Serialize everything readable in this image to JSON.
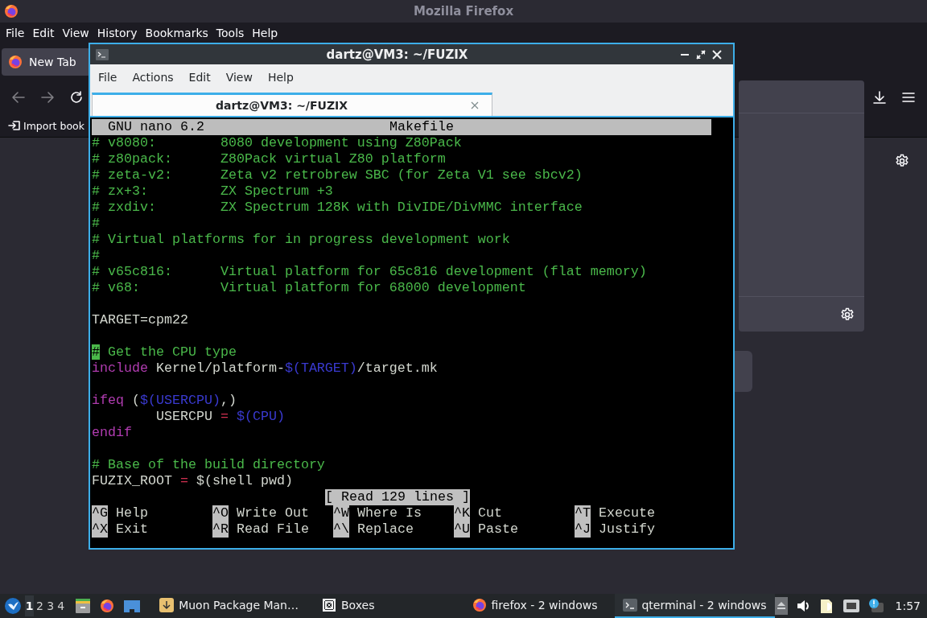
{
  "firefox": {
    "title": "Mozilla Firefox",
    "menu": [
      "File",
      "Edit",
      "View",
      "History",
      "Bookmarks",
      "Tools",
      "Help"
    ],
    "tabs": [
      {
        "label": "New Tab",
        "selected": true
      }
    ],
    "bookmarks": [
      "Import book"
    ]
  },
  "terminal": {
    "title": "dartz@VM3: ~/FUZIX",
    "menu": [
      "File",
      "Actions",
      "Edit",
      "View",
      "Help"
    ],
    "tabs": [
      {
        "label": "dartz@VM3: ~/FUZIX",
        "selected": true
      }
    ],
    "nano": {
      "version": "GNU nano 6.2",
      "filename": "Makefile",
      "lines": [
        {
          "kind": "text",
          "segments": [
            {
              "kind": "comment",
              "text": "# v8080:        8080 development using Z80Pack"
            }
          ]
        },
        {
          "kind": "text",
          "segments": [
            {
              "kind": "comment",
              "text": "# z80pack:      Z80Pack virtual Z80 platform"
            }
          ]
        },
        {
          "kind": "text",
          "segments": [
            {
              "kind": "comment",
              "text": "# zeta-v2:      Zeta v2 retrobrew SBC (for Zeta V1 see sbcv2)"
            }
          ]
        },
        {
          "kind": "text",
          "segments": [
            {
              "kind": "comment",
              "text": "# zx+3:         ZX Spectrum +3"
            }
          ]
        },
        {
          "kind": "text",
          "segments": [
            {
              "kind": "comment",
              "text": "# zxdiv:        ZX Spectrum 128K with DivIDE/DivMMC interface"
            }
          ]
        },
        {
          "kind": "text",
          "segments": [
            {
              "kind": "comment",
              "text": "#"
            }
          ]
        },
        {
          "kind": "text",
          "segments": [
            {
              "kind": "comment",
              "text": "# Virtual platforms for in progress development work"
            }
          ]
        },
        {
          "kind": "text",
          "segments": [
            {
              "kind": "comment",
              "text": "#"
            }
          ]
        },
        {
          "kind": "text",
          "segments": [
            {
              "kind": "comment",
              "text": "# v65c816:      Virtual platform for 65c816 development (flat memory)"
            }
          ]
        },
        {
          "kind": "text",
          "segments": [
            {
              "kind": "comment",
              "text": "# v68:          Virtual platform for 68000 development"
            }
          ]
        },
        {
          "kind": "blank"
        },
        {
          "kind": "text",
          "segments": [
            {
              "kind": "plain",
              "text": "TARGET=cpm22"
            }
          ]
        },
        {
          "kind": "blank"
        },
        {
          "kind": "text",
          "segments": [
            {
              "kind": "cursor",
              "text": "#"
            },
            {
              "kind": "comment",
              "text": " Get the CPU type"
            }
          ]
        },
        {
          "kind": "text",
          "segments": [
            {
              "kind": "keyword",
              "text": "include"
            },
            {
              "kind": "plain",
              "text": " Kernel/platform-"
            },
            {
              "kind": "variable",
              "text": "$(TARGET)"
            },
            {
              "kind": "plain",
              "text": "/target.mk"
            }
          ]
        },
        {
          "kind": "blank"
        },
        {
          "kind": "text",
          "segments": [
            {
              "kind": "keyword",
              "text": "ifeq"
            },
            {
              "kind": "plain",
              "text": " ("
            },
            {
              "kind": "variable",
              "text": "$(USERCPU)"
            },
            {
              "kind": "plain",
              "text": ",)"
            }
          ]
        },
        {
          "kind": "text",
          "segments": [
            {
              "kind": "plain",
              "text": "        USERCPU "
            },
            {
              "kind": "operator",
              "text": "= "
            },
            {
              "kind": "variable",
              "text": "$(CPU)"
            }
          ]
        },
        {
          "kind": "text",
          "segments": [
            {
              "kind": "keyword",
              "text": "endif"
            }
          ]
        },
        {
          "kind": "blank"
        },
        {
          "kind": "text",
          "segments": [
            {
              "kind": "comment",
              "text": "# Base of the build directory"
            }
          ]
        },
        {
          "kind": "text",
          "segments": [
            {
              "kind": "plain",
              "text": "FUZIX_ROOT "
            },
            {
              "kind": "operator",
              "text": "="
            },
            {
              "kind": "plain",
              "text": " $(shell pwd)"
            }
          ]
        }
      ],
      "status": "[ Read 129 lines ]",
      "shortcuts": [
        [
          {
            "key": "^G",
            "label": "Help"
          },
          {
            "key": "^O",
            "label": "Write Out"
          },
          {
            "key": "^W",
            "label": "Where Is"
          },
          {
            "key": "^K",
            "label": "Cut"
          },
          {
            "key": "^T",
            "label": "Execute"
          }
        ],
        [
          {
            "key": "^X",
            "label": "Exit"
          },
          {
            "key": "^R",
            "label": "Read File"
          },
          {
            "key": "^\\",
            "label": "Replace"
          },
          {
            "key": "^U",
            "label": "Paste"
          },
          {
            "key": "^J",
            "label": "Justify"
          }
        ]
      ]
    }
  },
  "taskbar": {
    "workspaces": [
      {
        "label": "1",
        "selected": true
      },
      {
        "label": "2",
        "selected": false
      },
      {
        "label": "3",
        "selected": false
      },
      {
        "label": "4",
        "selected": false
      }
    ],
    "tasks": [
      {
        "kind": "package",
        "label": "Muon Package Man…",
        "selected": false
      },
      {
        "kind": "boxes",
        "label": "Boxes",
        "selected": false
      },
      {
        "kind": "firefox",
        "label": "firefox - 2 windows",
        "selected": false
      },
      {
        "kind": "terminal",
        "label": "qterminal - 2 windows",
        "selected": true
      }
    ],
    "clock": "1:57"
  }
}
